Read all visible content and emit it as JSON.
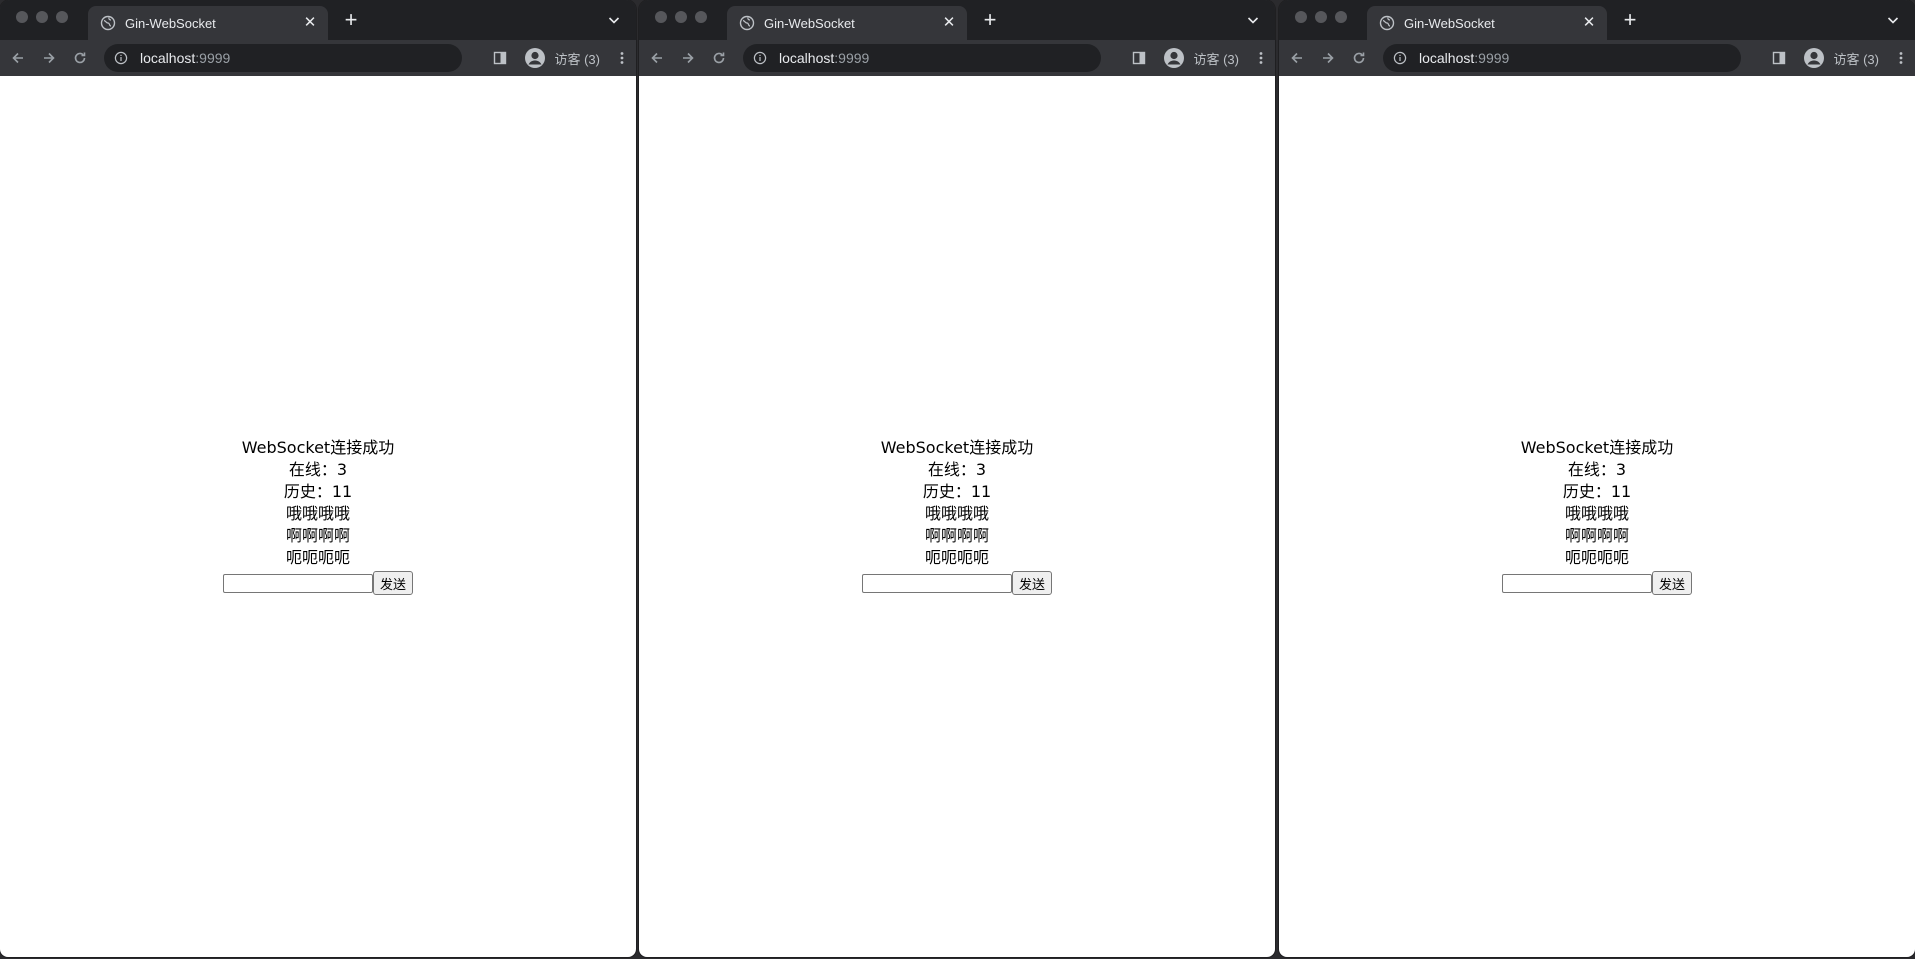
{
  "windows": [
    {
      "tab": {
        "title": "Gin-WebSocket"
      },
      "address": {
        "host": "localhost",
        "port": ":9999"
      },
      "profile": {
        "label": "访客 (3)"
      },
      "page": {
        "status": "WebSocket连接成功",
        "online": "在线：3",
        "history": "历史：11",
        "messages": [
          "哦哦哦哦",
          "啊啊啊啊",
          "呃呃呃呃"
        ],
        "input": {
          "value": "",
          "placeholder": ""
        },
        "send_label": "发送"
      }
    },
    {
      "tab": {
        "title": "Gin-WebSocket"
      },
      "address": {
        "host": "localhost",
        "port": ":9999"
      },
      "profile": {
        "label": "访客 (3)"
      },
      "page": {
        "status": "WebSocket连接成功",
        "online": "在线：3",
        "history": "历史：11",
        "messages": [
          "哦哦哦哦",
          "啊啊啊啊",
          "呃呃呃呃"
        ],
        "input": {
          "value": "",
          "placeholder": ""
        },
        "send_label": "发送"
      }
    },
    {
      "tab": {
        "title": "Gin-WebSocket"
      },
      "address": {
        "host": "localhost",
        "port": ":9999"
      },
      "profile": {
        "label": "访客 (3)"
      },
      "page": {
        "status": "WebSocket连接成功",
        "online": "在线：3",
        "history": "历史：11",
        "messages": [
          "哦哦哦哦",
          "啊啊啊啊",
          "呃呃呃呃"
        ],
        "input": {
          "value": "",
          "placeholder": ""
        },
        "send_label": "发送"
      }
    }
  ],
  "icons": {
    "favicon": "globe-icon",
    "close": "close-icon",
    "new_tab": "plus-icon",
    "tab_search": "chevron-down-icon",
    "back": "back-arrow-icon",
    "forward": "forward-arrow-icon",
    "reload": "reload-icon",
    "site_info": "info-icon",
    "side_panel": "side-panel-icon",
    "profile": "avatar-icon",
    "menu": "kebab-menu-icon"
  },
  "colors": {
    "tab_bar": "#202124",
    "toolbar": "#35363a",
    "omnibox": "#202124",
    "page_background": "#ffffff"
  }
}
